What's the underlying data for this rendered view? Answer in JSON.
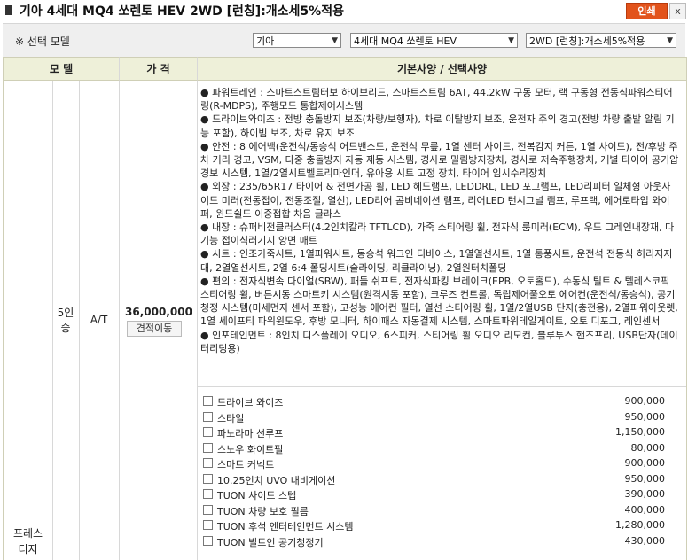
{
  "header": {
    "title": "기아 4세대 MQ4 쏘렌토 HEV 2WD [런칭]:개소세5%적용",
    "print_label": "인쇄",
    "close_label": "x"
  },
  "selector": {
    "label": "※ 선택 모델",
    "brand": "기아",
    "model": "4세대 MQ4 쏘렌토 HEV",
    "trim": "2WD [런칭]:개소세5%적용"
  },
  "table": {
    "col_model": "모 델",
    "col_price": "가 격",
    "col_specs": "기본사양 / 선택사양",
    "row": {
      "trim_name_1": "프레스",
      "trim_name_2": "티지",
      "seats_1": "5인",
      "seats_2": "승",
      "transmission": "A/T",
      "price": "36,000,000",
      "quote_button": "견적이동"
    },
    "specs": [
      "● 파워트레인 : 스마트스트림터보 하이브리드, 스마트스트림 6AT, 44.2kW 구동 모터, 랙 구동형 전동식파워스티어링(R-MDPS), 주행모드 통합제어시스템",
      "● 드라이브와이즈 : 전방 충돌방지 보조(차량/보행자), 차로 이탈방지 보조, 운전자 주의 경고(전방 차량 출발 알림 기능 포함), 하이빔 보조, 차로 유지 보조",
      "● 안전 : 8 에어백(운전석/동승석 어드밴스드, 운전석 무릎, 1열 센터 사이드, 전복감지 커튼, 1열 사이드), 전/후방 주차 거리 경고, VSM, 다중 충돌방지 자동 제동 시스템, 경사로 밀림방지장치, 경사로 저속주행장치, 개별 타이어 공기압 경보 시스템, 1열/2열시트벨트리마인더, 유아용 시트 고정 장치, 타이어 임시수리장치",
      "● 외장 : 235/65R17 타이어 & 전면가공 휠, LED 헤드램프, LEDDRL, LED 포그램프, LED리피터 일체형 아웃사이드 미러(전동접이, 전동조절, 열선), LED리어 콤비네이션 램프, 리어LED 턴시그널 램프, 루프랙, 에어로타입 와이퍼, 윈드쉴드 이중접합 차음 글라스",
      "● 내장 : 슈퍼비전클러스터(4.2인치칼라 TFTLCD), 가죽 스티어링 휠, 전자식 룸미러(ECM), 우드 그레인내장재, 다기능 접이식러기지 양면 매트",
      "● 시트 : 인조가죽시트, 1열파워시트, 동승석 워크인 디바이스, 1열열선시트, 1열 통풍시트, 운전석 전동식 허리지지대, 2열열선시트, 2열 6:4 폴딩시트(슬라이딩, 리클라이닝), 2열원터치폴딩",
      "● 편의 : 전자식변속 다이얼(SBW), 패들 쉬프트, 전자식파킹 브레이크(EPB, 오토홀드), 수동식 틸트 & 텔레스코픽 스티어링 휠, 버튼시동 스마트키 시스템(원격시동 포함), 크루즈 컨트롤, 독립제어풀오토 에어컨(운전석/동승석), 공기청정 시스템(미세먼지 센서 포함), 고성능 에어컨 필터, 열선 스티어링 휠, 1열/2열USB 단자(충전용), 2열파워아웃렛, 1열 세이프티 파워윈도우, 후방 모니터, 하이패스 자동결제 시스템, 스마트파워테일게이트, 오토 디포그, 레인센서",
      "● 인포테인먼트 : 8인치 디스플레이 오디오, 6스피커, 스티어링 휠 오디오 리모컨, 블루투스 핸즈프리, USB단자(데이터리딩용)"
    ],
    "options": [
      {
        "name": "드라이브 와이즈",
        "price": "900,000"
      },
      {
        "name": "스타일",
        "price": "950,000"
      },
      {
        "name": "파노라마 선루프",
        "price": "1,150,000"
      },
      {
        "name": "스노우 화이트펄",
        "price": "80,000"
      },
      {
        "name": "스마트 커넥트",
        "price": "900,000"
      },
      {
        "name": "10.25인치 UVO 내비게이션",
        "price": "950,000"
      },
      {
        "name": "TUON 사이드 스텝",
        "price": "390,000"
      },
      {
        "name": "TUON 차량 보호 필름",
        "price": "400,000"
      },
      {
        "name": "TUON 후석 엔터테인먼트 시스템",
        "price": "1,280,000"
      },
      {
        "name": "TUON 빌트인 공기청정기",
        "price": "430,000"
      }
    ]
  }
}
